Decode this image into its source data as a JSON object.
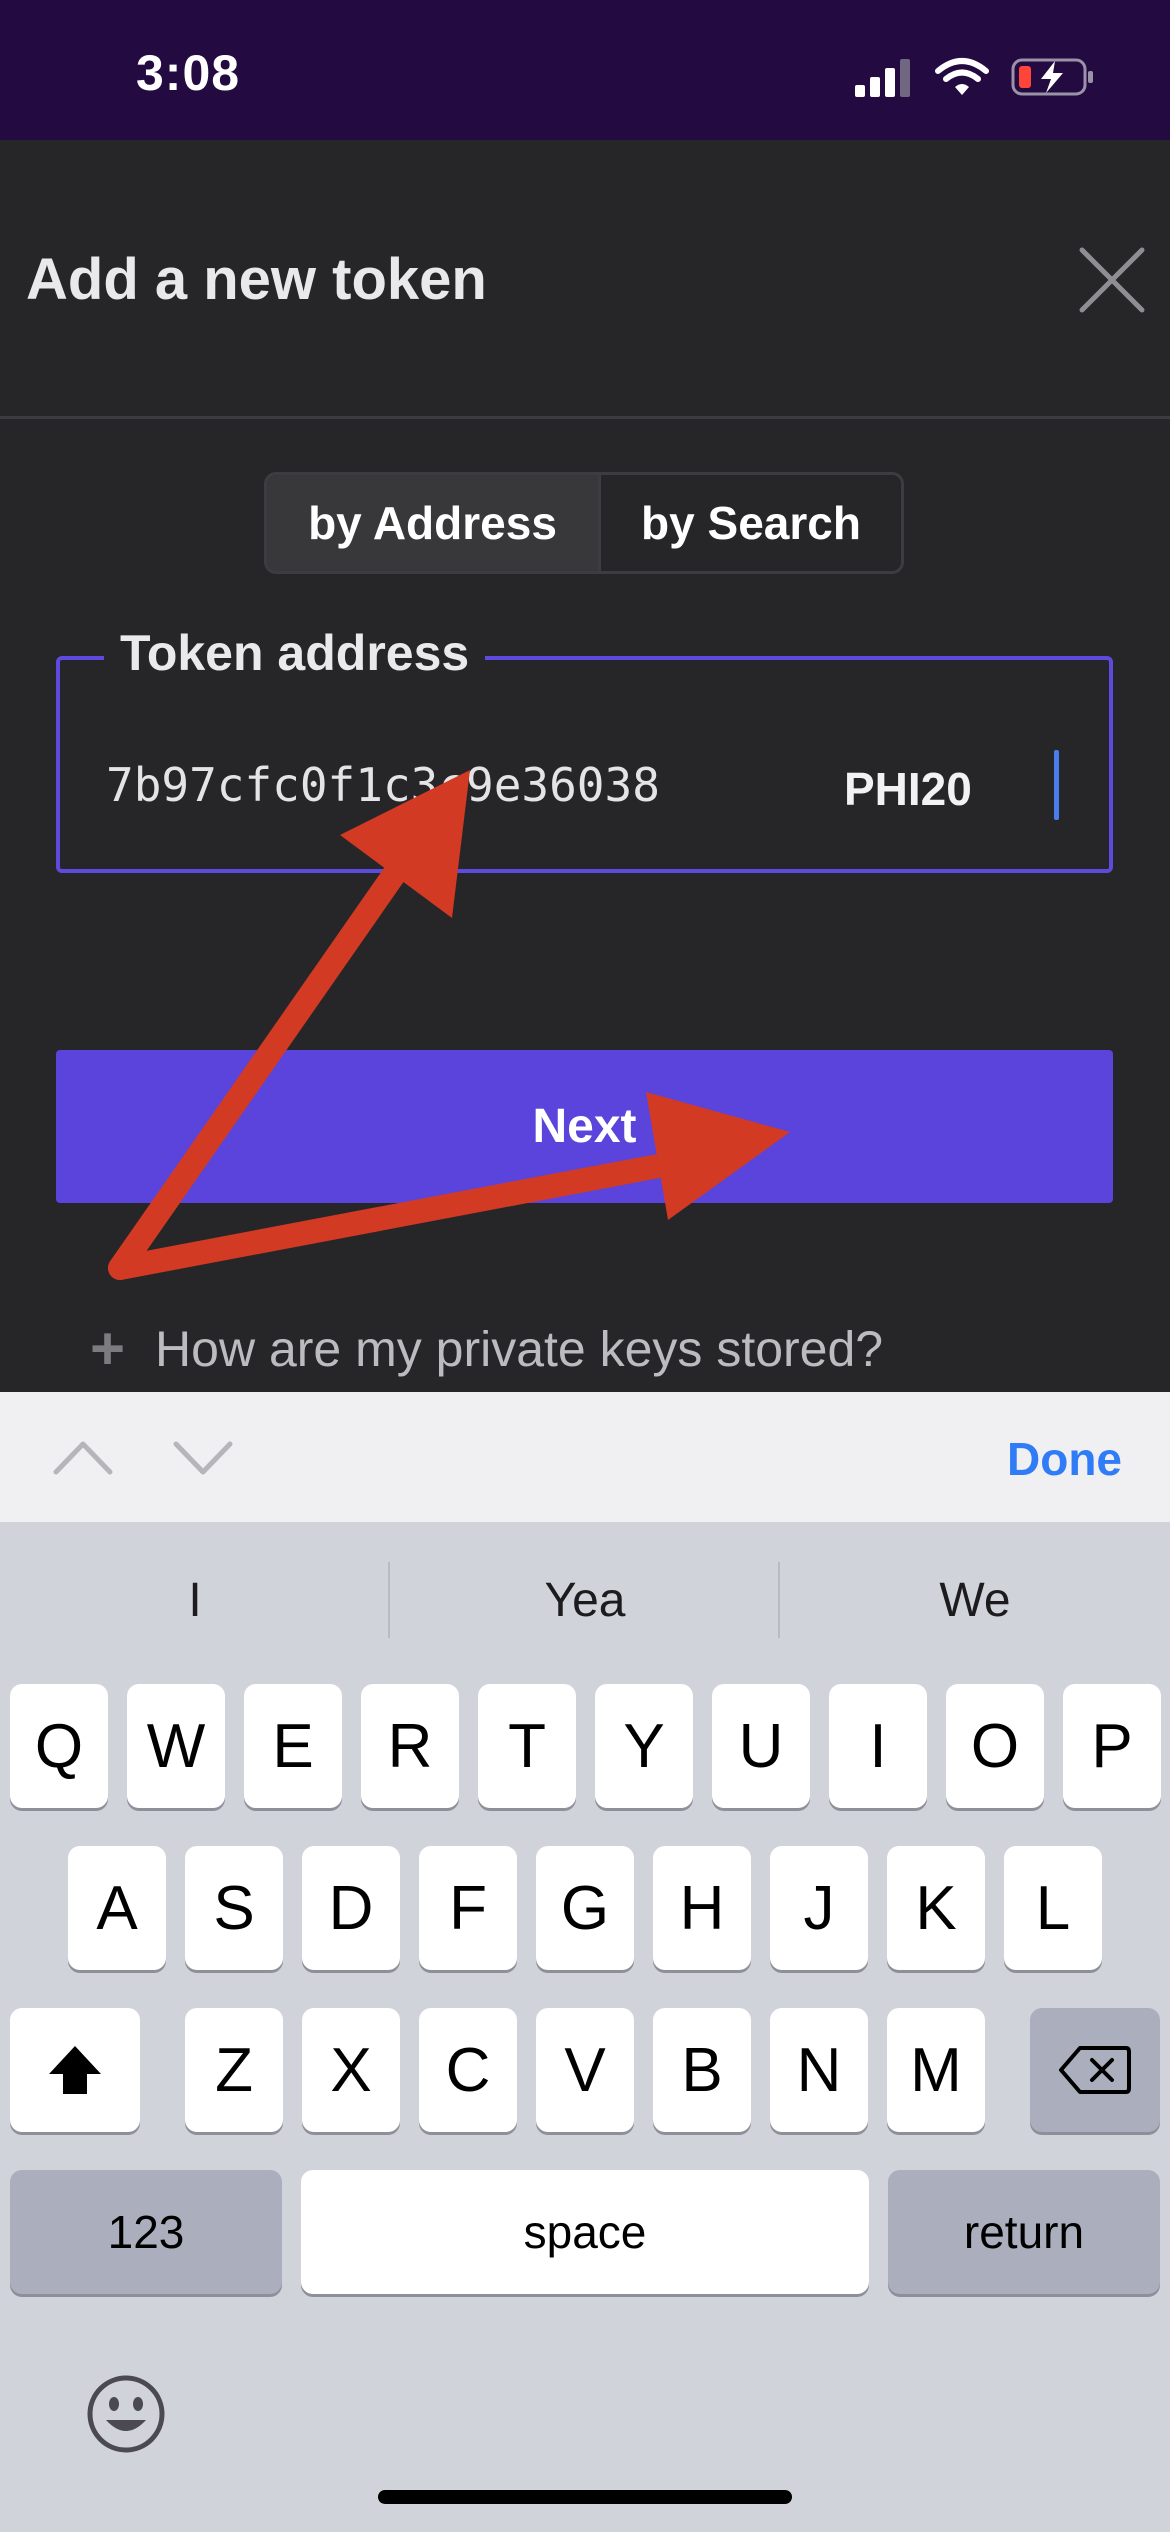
{
  "status_bar": {
    "time": "3:08",
    "icons": [
      "cellular-signal-icon",
      "wifi-icon",
      "battery-charging-icon"
    ]
  },
  "modal": {
    "title": "Add a new token",
    "close_icon": "close-icon",
    "tabs": [
      {
        "label": "by Address",
        "active": true
      },
      {
        "label": "by Search",
        "active": false
      }
    ],
    "address_field": {
      "legend": "Token address",
      "value": "7b97cfc0f1c3c9e36038",
      "token_standard": "PHI20"
    },
    "next_label": "Next"
  },
  "faq": {
    "question": "How are my private keys stored?",
    "icon": "plus-icon"
  },
  "keyboard": {
    "toolbar": {
      "done_label": "Done",
      "prev_icon": "chevron-up-icon",
      "next_icon": "chevron-down-icon"
    },
    "suggestions": [
      "I",
      "Yea",
      "We"
    ],
    "row1": [
      "Q",
      "W",
      "E",
      "R",
      "T",
      "Y",
      "U",
      "I",
      "O",
      "P"
    ],
    "row2": [
      "A",
      "S",
      "D",
      "F",
      "G",
      "H",
      "J",
      "K",
      "L"
    ],
    "row3": [
      "Z",
      "X",
      "C",
      "V",
      "B",
      "N",
      "M"
    ],
    "shift_icon": "shift-icon",
    "backspace_icon": "backspace-icon",
    "numbers_label": "123",
    "space_label": "space",
    "return_label": "return",
    "emoji_icon": "emoji-icon"
  },
  "colors": {
    "accent": "#5a44db",
    "annotation_arrow": "#d23a24",
    "link_blue": "#2f7cf6"
  }
}
